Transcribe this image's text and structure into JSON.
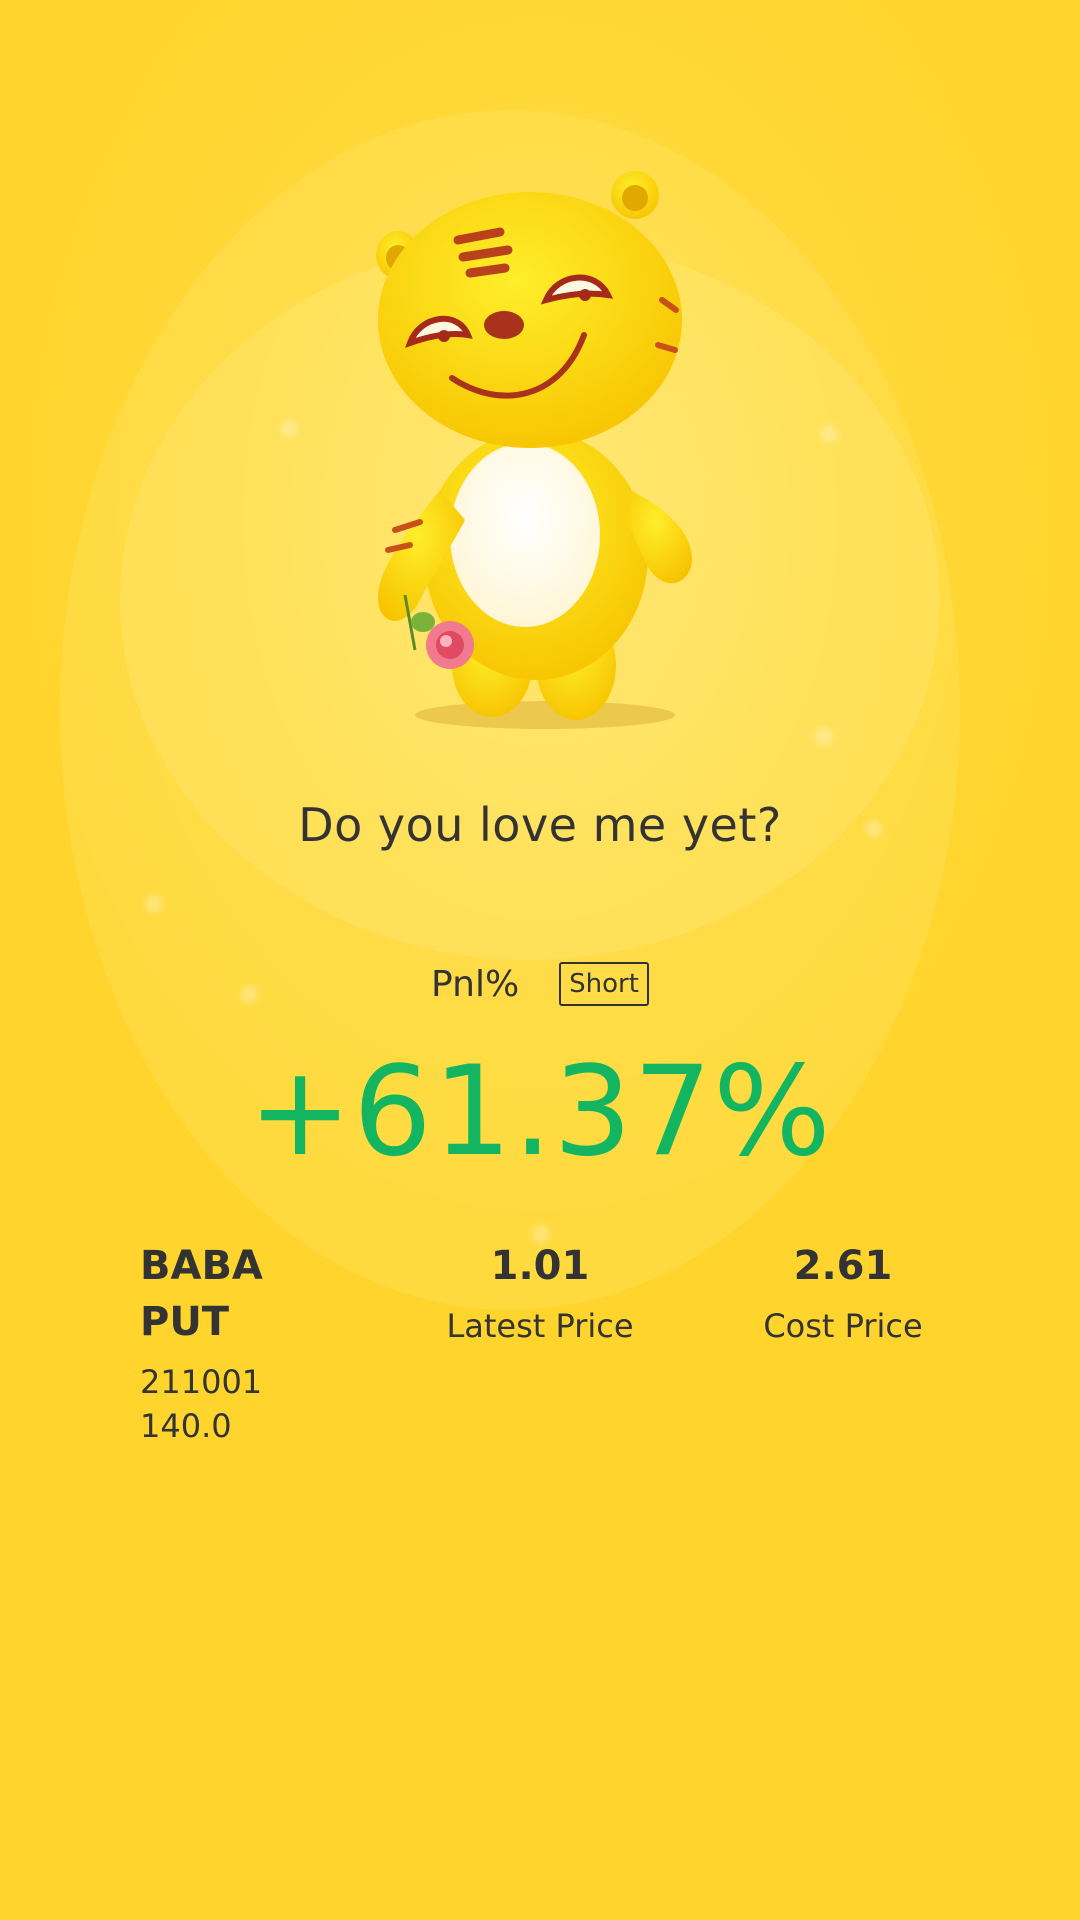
{
  "headline": "Do you love me yet?",
  "pnl": {
    "label": "Pnl%",
    "badge": "Short",
    "value": "+61.37%"
  },
  "stats": {
    "symbol": "BABA PUT",
    "contract": "211001 140.0",
    "latest_price_value": "1.01",
    "latest_price_label": "Latest Price",
    "cost_price_value": "2.61",
    "cost_price_label": "Cost Price"
  },
  "colors": {
    "background": "#ffd52d",
    "profit_green": "#13b560",
    "text_dark": "#333333"
  },
  "icons": {
    "mascot": "tiger-mascot-with-flower"
  }
}
